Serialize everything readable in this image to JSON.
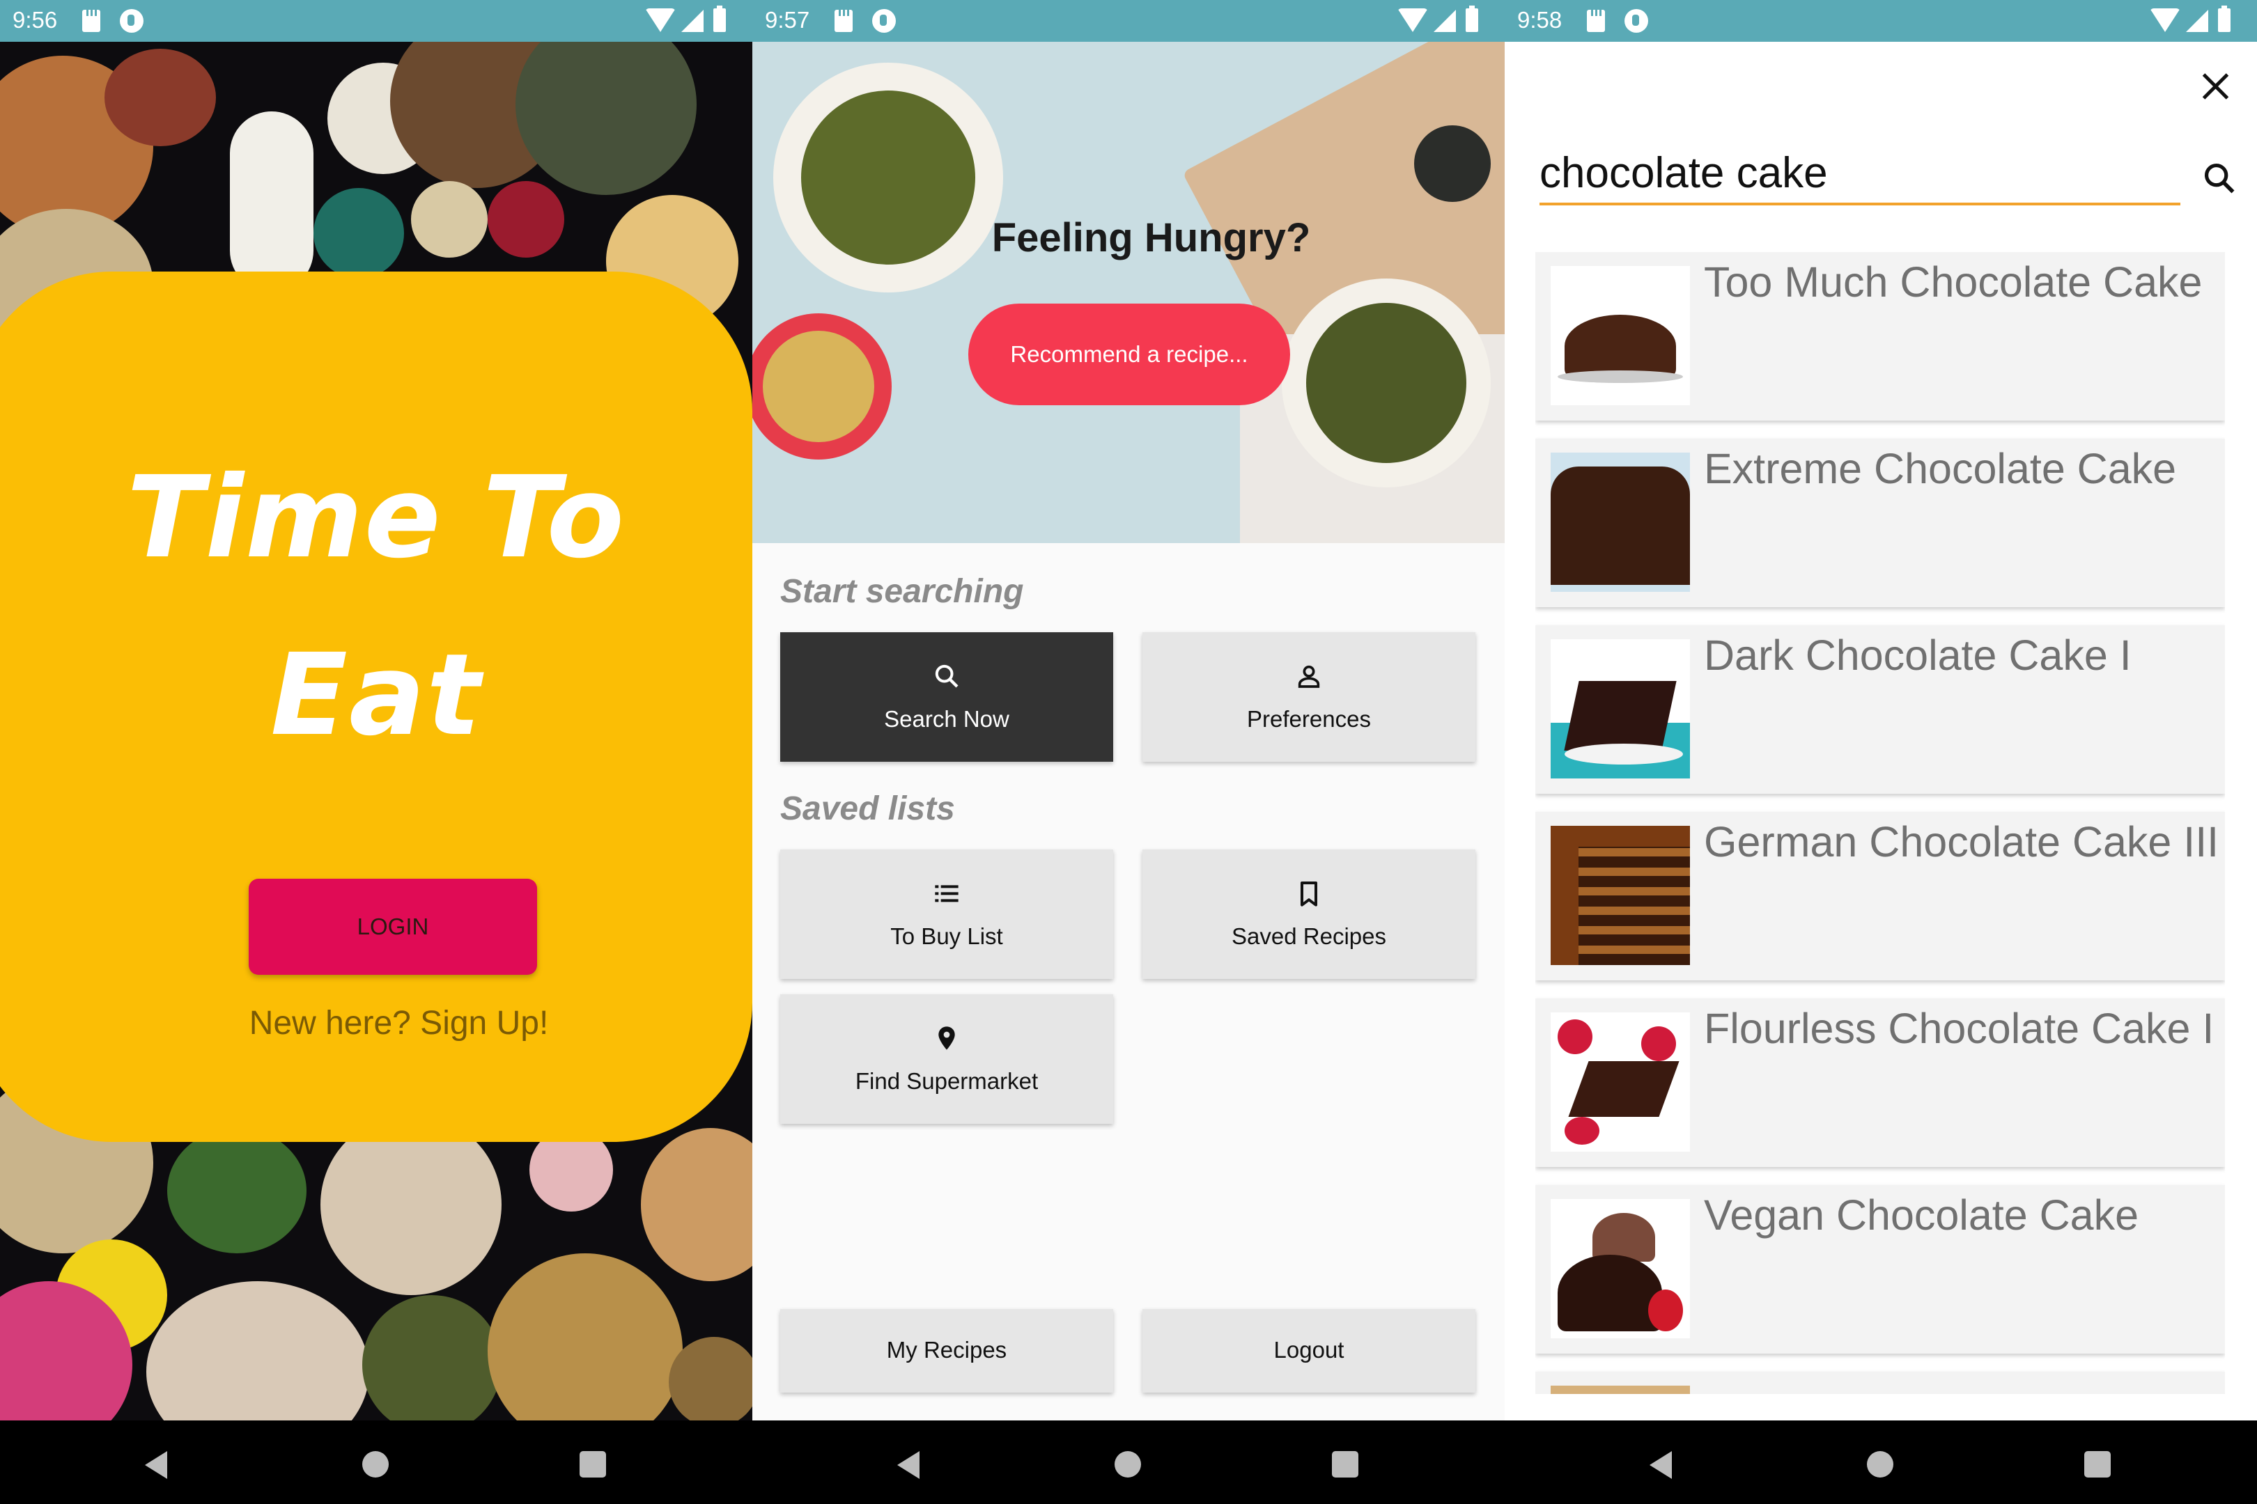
{
  "screens": [
    {
      "status_time": "9:56",
      "app_title_line1": "Time To",
      "app_title_line2": "Eat",
      "login_label": "LOGIN",
      "signup_label": "New here? Sign Up!"
    },
    {
      "status_time": "9:57",
      "hero_title": "Feeling Hungry?",
      "recommend_label": "Recommend a recipe...",
      "section_search": "Start searching",
      "section_saved": "Saved lists",
      "tiles": {
        "search_now": "Search Now",
        "preferences": "Preferences",
        "to_buy_list": "To Buy List",
        "saved_recipes": "Saved Recipes",
        "find_supermarket": "Find Supermarket",
        "my_recipes": "My Recipes",
        "logout": "Logout"
      }
    },
    {
      "status_time": "9:58",
      "search_query": "chocolate cake",
      "results": [
        "Too Much Chocolate Cake",
        "Extreme Chocolate Cake",
        "Dark Chocolate Cake I",
        "German Chocolate Cake III",
        "Flourless Chocolate Cake I",
        "Vegan Chocolate Cake"
      ]
    }
  ],
  "colors": {
    "status_bar": "#5aaab6",
    "accent_yellow": "#fbbe05",
    "login_button": "#e00b55",
    "recommend_button": "#f53950",
    "search_underline": "#f2a22b",
    "dark_tile": "#333333"
  },
  "icons": [
    "search-icon",
    "person-icon",
    "list-icon",
    "bookmark-icon",
    "location-pin-icon",
    "close-icon",
    "back-icon",
    "home-icon",
    "recents-icon"
  ]
}
